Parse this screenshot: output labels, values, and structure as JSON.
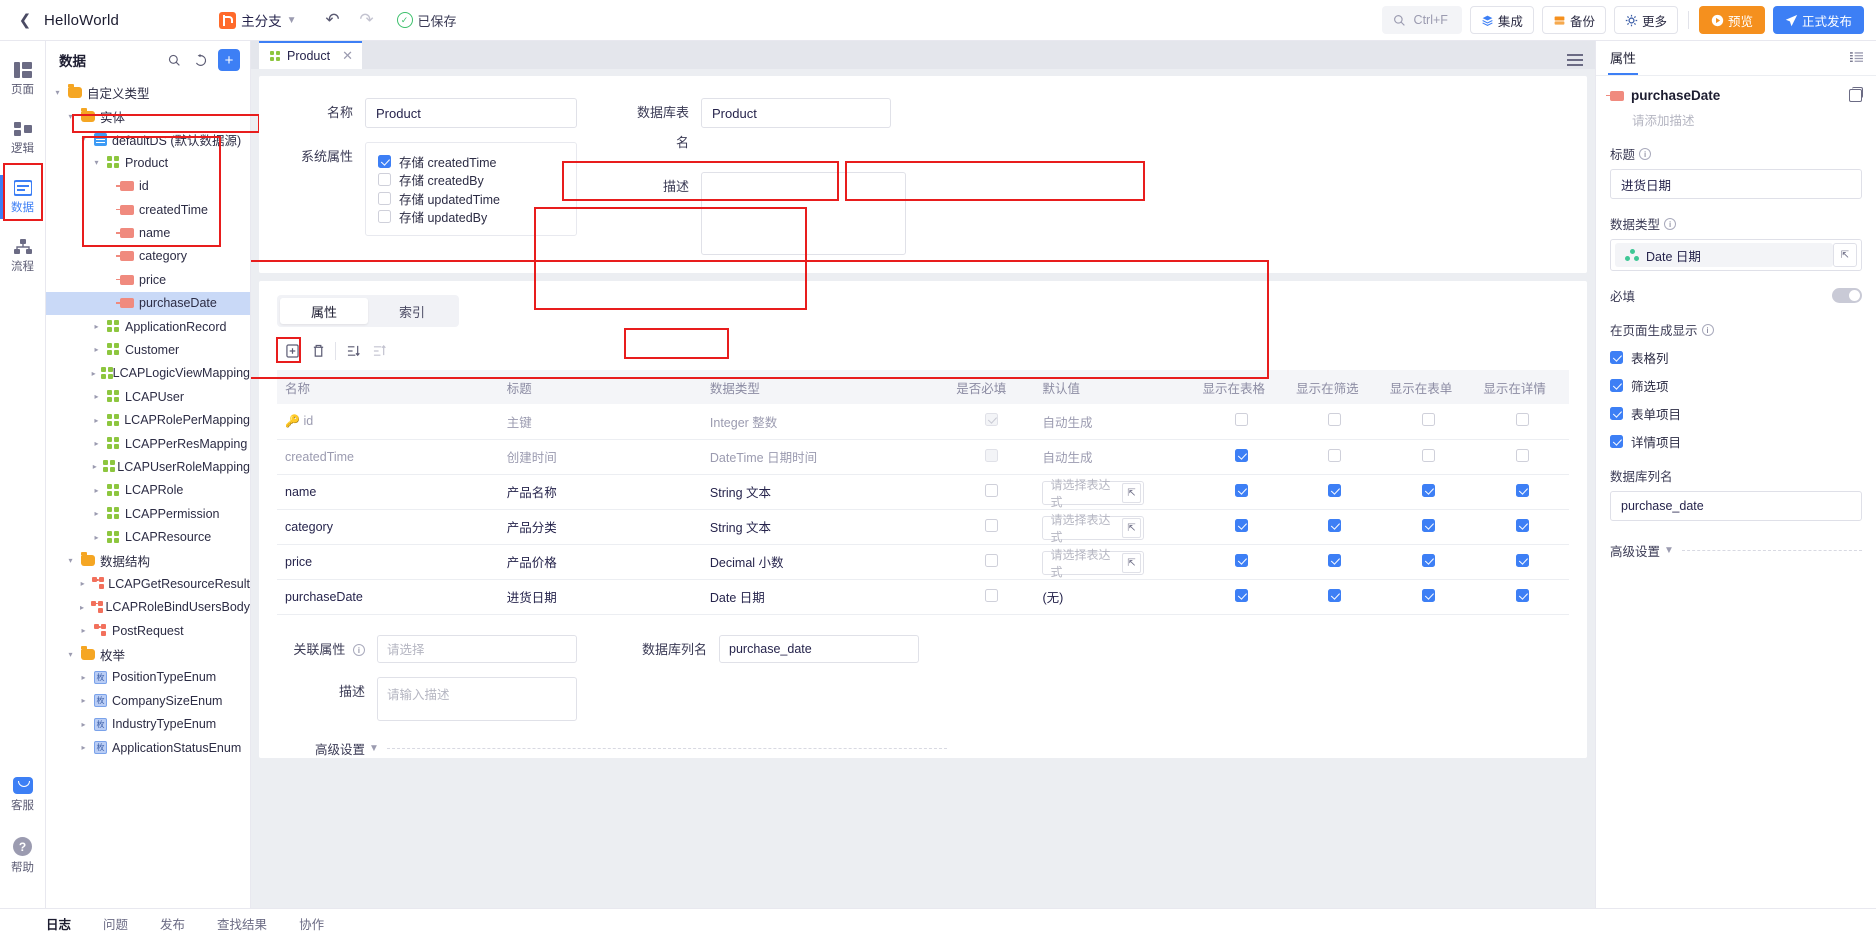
{
  "topbar": {
    "app_name": "HelloWorld",
    "branch": "主分支",
    "saved": "已保存",
    "search_placeholder": "Ctrl+F",
    "integration": "集成",
    "backup": "备份",
    "more": "更多",
    "preview": "预览",
    "publish": "正式发布",
    "accent_blue": "#3d7ff5",
    "accent_orange": "#f5901e"
  },
  "rail": {
    "items": [
      {
        "label": "页面",
        "icon": "page-icon"
      },
      {
        "label": "逻辑",
        "icon": "logic-icon"
      },
      {
        "label": "数据",
        "icon": "data-icon"
      },
      {
        "label": "流程",
        "icon": "flow-icon"
      }
    ],
    "bottom": [
      {
        "label": "客服",
        "icon": "customer-service-icon"
      },
      {
        "label": "帮助",
        "icon": "help-icon"
      }
    ]
  },
  "tree": {
    "title": "数据",
    "nodes": [
      {
        "label": "自定义类型",
        "icon": "folder-icon",
        "indent": 0,
        "twisty": "▾"
      },
      {
        "label": "实体",
        "icon": "folder-icon",
        "indent": 1,
        "twisty": "▾"
      },
      {
        "label": "defaultDS (默认数据源)",
        "icon": "datasource-icon",
        "indent": 2,
        "twisty": "▾"
      },
      {
        "label": "Product",
        "icon": "entity-icon",
        "indent": 3,
        "twisty": "▾"
      },
      {
        "label": "id",
        "icon": "field-icon",
        "indent": 4,
        "twisty": ""
      },
      {
        "label": "createdTime",
        "icon": "field-icon",
        "indent": 4,
        "twisty": ""
      },
      {
        "label": "name",
        "icon": "field-icon",
        "indent": 4,
        "twisty": ""
      },
      {
        "label": "category",
        "icon": "field-icon",
        "indent": 4,
        "twisty": ""
      },
      {
        "label": "price",
        "icon": "field-icon",
        "indent": 4,
        "twisty": ""
      },
      {
        "label": "purchaseDate",
        "icon": "field-icon",
        "indent": 4,
        "twisty": "",
        "selected": true
      },
      {
        "label": "ApplicationRecord",
        "icon": "entity-icon",
        "indent": 3,
        "twisty": "▸"
      },
      {
        "label": "Customer",
        "icon": "entity-icon",
        "indent": 3,
        "twisty": "▸"
      },
      {
        "label": "LCAPLogicViewMapping",
        "icon": "entity-icon",
        "indent": 3,
        "twisty": "▸"
      },
      {
        "label": "LCAPUser",
        "icon": "entity-icon",
        "indent": 3,
        "twisty": "▸"
      },
      {
        "label": "LCAPRolePerMapping",
        "icon": "entity-icon",
        "indent": 3,
        "twisty": "▸"
      },
      {
        "label": "LCAPPerResMapping",
        "icon": "entity-icon",
        "indent": 3,
        "twisty": "▸"
      },
      {
        "label": "LCAPUserRoleMapping",
        "icon": "entity-icon",
        "indent": 3,
        "twisty": "▸"
      },
      {
        "label": "LCAPRole",
        "icon": "entity-icon",
        "indent": 3,
        "twisty": "▸"
      },
      {
        "label": "LCAPPermission",
        "icon": "entity-icon",
        "indent": 3,
        "twisty": "▸"
      },
      {
        "label": "LCAPResource",
        "icon": "entity-icon",
        "indent": 3,
        "twisty": "▸"
      },
      {
        "label": "数据结构",
        "icon": "folder-icon",
        "indent": 1,
        "twisty": "▾"
      },
      {
        "label": "LCAPGetResourceResult",
        "icon": "struct-icon",
        "indent": 2,
        "twisty": "▸"
      },
      {
        "label": "LCAPRoleBindUsersBody",
        "icon": "struct-icon",
        "indent": 2,
        "twisty": "▸"
      },
      {
        "label": "PostRequest",
        "icon": "struct-icon",
        "indent": 2,
        "twisty": "▸"
      },
      {
        "label": "枚举",
        "icon": "folder-icon",
        "indent": 1,
        "twisty": "▾"
      },
      {
        "label": "PositionTypeEnum",
        "icon": "enum-icon",
        "indent": 2,
        "twisty": "▸"
      },
      {
        "label": "CompanySizeEnum",
        "icon": "enum-icon",
        "indent": 2,
        "twisty": "▸"
      },
      {
        "label": "IndustryTypeEnum",
        "icon": "enum-icon",
        "indent": 2,
        "twisty": "▸"
      },
      {
        "label": "ApplicationStatusEnum",
        "icon": "enum-icon",
        "indent": 2,
        "twisty": "▸"
      }
    ]
  },
  "tab": {
    "label": "Product"
  },
  "form": {
    "name_label": "名称",
    "name_value": "Product",
    "table_label": "数据库表名",
    "table_value": "Product",
    "sysattr_label": "系统属性",
    "sysattr": [
      {
        "label": "存储 createdTime",
        "checked": true
      },
      {
        "label": "存储 createdBy",
        "checked": false
      },
      {
        "label": "存储 updatedTime",
        "checked": false
      },
      {
        "label": "存储 updatedBy",
        "checked": false
      }
    ],
    "desc_label": "描述",
    "desc_value": ""
  },
  "segs": [
    {
      "label": "属性",
      "active": true
    },
    {
      "label": "索引",
      "active": false
    }
  ],
  "table": {
    "headers": [
      "名称",
      "标题",
      "数据类型",
      "是否必填",
      "默认值",
      "显示在表格",
      "显示在筛选",
      "显示在表单",
      "显示在详情"
    ],
    "expr_placeholder": "请选择表达式",
    "rows": [
      {
        "name": "id",
        "title": "主键",
        "type": "Integer 整数",
        "required": "disabled-checked",
        "default": "自动生成",
        "default_kind": "text",
        "in_table": "off-disabled",
        "in_filter": "off-disabled",
        "in_form": "off-disabled",
        "in_detail": "off-disabled",
        "muted": true,
        "key": true
      },
      {
        "name": "createdTime",
        "title": "创建时间",
        "type": "DateTime 日期时间",
        "required": "disabled",
        "default": "自动生成",
        "default_kind": "text",
        "in_table": "on",
        "in_filter": "off-disabled",
        "in_form": "off-disabled",
        "in_detail": "off-disabled",
        "muted": true,
        "key": false
      },
      {
        "name": "name",
        "title": "产品名称",
        "type": "String 文本",
        "required": "off",
        "default": "请选择表达式",
        "default_kind": "expr",
        "in_table": "on",
        "in_filter": "on",
        "in_form": "on",
        "in_detail": "on",
        "muted": false,
        "key": false
      },
      {
        "name": "category",
        "title": "产品分类",
        "type": "String 文本",
        "required": "off",
        "default": "请选择表达式",
        "default_kind": "expr",
        "in_table": "on",
        "in_filter": "on",
        "in_form": "on",
        "in_detail": "on",
        "muted": false,
        "key": false
      },
      {
        "name": "price",
        "title": "产品价格",
        "type": "Decimal 小数",
        "required": "off",
        "default": "请选择表达式",
        "default_kind": "expr",
        "in_table": "on",
        "in_filter": "on",
        "in_form": "on",
        "in_detail": "on",
        "muted": false,
        "key": false,
        "type_highlight": true
      },
      {
        "name": "purchaseDate",
        "title": "进货日期",
        "type": "Date 日期",
        "required": "off",
        "default": "(无)",
        "default_kind": "text",
        "in_table": "on",
        "in_filter": "on",
        "in_form": "on",
        "in_detail": "on",
        "muted": false,
        "key": false,
        "selected": true
      }
    ]
  },
  "detail": {
    "relation_label": "关联属性",
    "relation_placeholder": "请选择",
    "dbcol_label": "数据库列名",
    "dbcol_value": "purchase_date",
    "desc_label": "描述",
    "desc_placeholder": "请输入描述",
    "advanced_label": "高级设置"
  },
  "right": {
    "tab_label": "属性",
    "field_name": "purchaseDate",
    "desc_placeholder": "请添加描述",
    "title_label": "标题",
    "title_value": "进货日期",
    "type_label": "数据类型",
    "type_value": "Date 日期",
    "required_label": "必填",
    "required_on": false,
    "display_label": "在页面生成显示",
    "display_items": [
      {
        "label": "表格列",
        "checked": true
      },
      {
        "label": "筛选项",
        "checked": true
      },
      {
        "label": "表单项目",
        "checked": true
      },
      {
        "label": "详情项目",
        "checked": true
      }
    ],
    "dbcol_label": "数据库列名",
    "dbcol_value": "purchase_date",
    "advanced_label": "高级设置"
  },
  "bottombar": {
    "items": [
      {
        "label": "日志",
        "active": true
      },
      {
        "label": "问题",
        "active": false
      },
      {
        "label": "发布",
        "active": false
      },
      {
        "label": "查找结果",
        "active": false
      },
      {
        "label": "协作",
        "active": false
      }
    ]
  }
}
